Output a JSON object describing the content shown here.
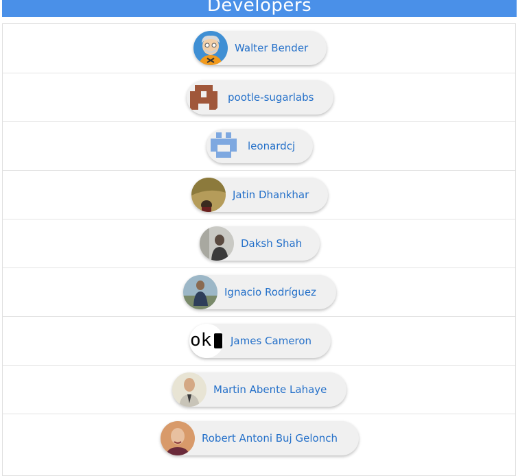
{
  "header": {
    "title": "Developers"
  },
  "developers": [
    {
      "name": "Walter Bender",
      "avatar_icon": "cartoon-person-avatar-icon"
    },
    {
      "name": "pootle-sugarlabs",
      "avatar_icon": "identicon-avatar-icon"
    },
    {
      "name": "leonardcj",
      "avatar_icon": "identicon-avatar-icon"
    },
    {
      "name": "Jatin Dhankhar",
      "avatar_icon": "photo-avatar-icon"
    },
    {
      "name": "Daksh Shah",
      "avatar_icon": "photo-avatar-icon"
    },
    {
      "name": "Ignacio Rodríguez",
      "avatar_icon": "photo-avatar-icon"
    },
    {
      "name": "James Cameron",
      "avatar_icon": "ok-logo-avatar-icon",
      "avatar_text": "ok"
    },
    {
      "name": "Martin Abente Lahaye",
      "avatar_icon": "photo-avatar-icon"
    },
    {
      "name": "Robert Antoni Buj Gelonch",
      "avatar_icon": "photo-avatar-icon"
    }
  ],
  "colors": {
    "header_bg": "#4a90e8",
    "link": "#2470c9",
    "chip_bg": "#f0f0f0",
    "pootle_identicon": "#a0573a",
    "leonardcj_identicon": "#7ea8e0"
  }
}
